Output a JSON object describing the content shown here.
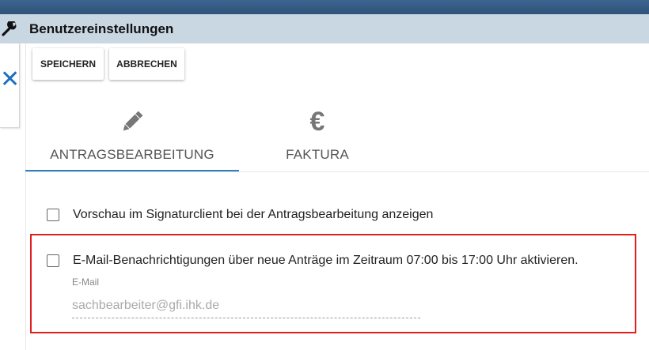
{
  "header": {
    "title": "Benutzereinstellungen",
    "icon": "wrench-icon"
  },
  "sidebar": {
    "close_icon": "close-icon"
  },
  "toolbar": {
    "save_label": "SPEICHERN",
    "cancel_label": "ABBRECHEN"
  },
  "tabs": [
    {
      "label": "ANTRAGSBEARBEITUNG",
      "icon": "pencil-icon",
      "active": true
    },
    {
      "label": "FAKTURA",
      "icon": "euro-icon",
      "glyph": "€",
      "active": false
    }
  ],
  "options": {
    "preview_label": "Vorschau im Signaturclient bei der Antragsbearbeitung anzeigen",
    "preview_checked": false,
    "email_label": "E-Mail-Benachrichtigungen über neue Anträge im Zeitraum 07:00 bis 17:00 Uhr aktivieren.",
    "email_checked": false,
    "email_field": {
      "label": "E-Mail",
      "value": "",
      "placeholder": "sachbearbeiter@gfi.ihk.de"
    }
  },
  "colors": {
    "topbar": "#2f5379",
    "titlebar": "#c9d7e3",
    "accent": "#2f7ec1",
    "highlight_border": "#e02020"
  }
}
